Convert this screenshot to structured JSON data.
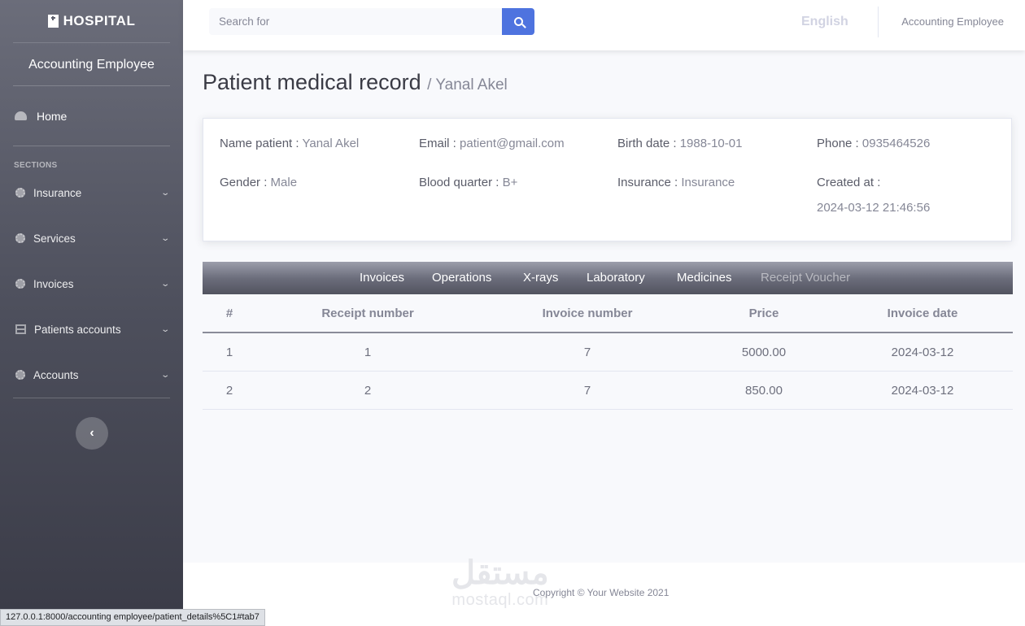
{
  "sidebar": {
    "brand": "HOSPITAL",
    "role": "Accounting Employee",
    "home": "Home",
    "section_label": "SECTIONS",
    "items": [
      {
        "label": "Insurance",
        "icon": "gear-icon"
      },
      {
        "label": "Services",
        "icon": "gear-icon"
      },
      {
        "label": "Invoices",
        "icon": "gear-icon"
      },
      {
        "label": "Patients accounts",
        "icon": "table-icon"
      },
      {
        "label": "Accounts",
        "icon": "gear-icon"
      }
    ]
  },
  "topbar": {
    "search_placeholder": "Search for",
    "language": "English",
    "user": "Accounting Employee"
  },
  "page": {
    "title": "Patient medical record",
    "subtitle": "/ Yanal Akel"
  },
  "patient": {
    "name_label": "Name patient :",
    "name": "Yanal Akel",
    "email_label": "Email :",
    "email": "patient@gmail.com",
    "birth_label": "Birth date :",
    "birth": "1988-10-01",
    "phone_label": "Phone :",
    "phone": "0935464526",
    "gender_label": "Gender :",
    "gender": "Male",
    "blood_label": "Blood quarter :",
    "blood": "B+",
    "insurance_label": "Insurance :",
    "insurance": "Insurance",
    "created_label": "Created at :",
    "created": "2024-03-12 21:46:56"
  },
  "tabs": [
    "Invoices",
    "Operations",
    "X-rays",
    "Laboratory",
    "Medicines",
    "Receipt Voucher"
  ],
  "table": {
    "headers": [
      "#",
      "Receipt number",
      "Invoice number",
      "Price",
      "Invoice date"
    ],
    "rows": [
      [
        "1",
        "1",
        "7",
        "5000.00",
        "2024-03-12"
      ],
      [
        "2",
        "2",
        "7",
        "850.00",
        "2024-03-12"
      ]
    ]
  },
  "footer": {
    "copyright": "Copyright © Your Website 2021",
    "watermark_ar": "مستقل",
    "watermark_lat": "mostaql.com"
  },
  "status_url": "127.0.0.1:8000/accounting employee/patient_details%5C1#tab7",
  "colors": {
    "accent": "#4e73df",
    "sidebar_top": "#6b6d7a",
    "sidebar_bottom": "#3a3b47"
  }
}
